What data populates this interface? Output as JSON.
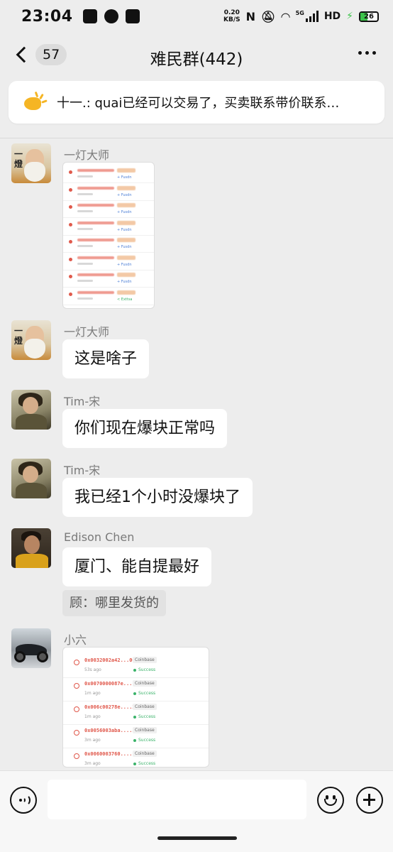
{
  "status_bar": {
    "time": "23:04",
    "net_speed_value": "0.20",
    "net_speed_unit": "KB/S",
    "network": "HD",
    "signal_label": "5G",
    "battery": "26",
    "left_icons": [
      "telegram-icon",
      "wechat-icon",
      "qq-icon"
    ],
    "right_icons": [
      "nfc-icon",
      "mute-icon",
      "wifi-icon",
      "signal-icon",
      "charging-icon",
      "battery-icon"
    ]
  },
  "nav": {
    "back_count": "57",
    "title": "难民群(442)"
  },
  "announcement": {
    "text": "十一.: quai已经可以交易了，买卖联系带价联系…"
  },
  "messages": [
    {
      "sender": "一灯大师",
      "type": "image"
    },
    {
      "sender": "一灯大师",
      "type": "text",
      "text": "这是啥子"
    },
    {
      "sender": "Tim-宋",
      "type": "text",
      "text": "你们现在爆块正常吗"
    },
    {
      "sender": "Tim-宋",
      "type": "text",
      "text": "我已经1个小时没爆块了"
    },
    {
      "sender": "Edison Chen",
      "type": "text",
      "text": "厦门、能自提最好",
      "quote": "顾：哪里发货的"
    },
    {
      "sender": "小六",
      "type": "image"
    }
  ],
  "screenshot_1": {
    "rows": [
      {
        "status": "+ Fusdn"
      },
      {
        "status": "+ Fusdn"
      },
      {
        "status": "+ Fusdn"
      },
      {
        "status": "+ Fusdn"
      },
      {
        "status": "+ Fusdn"
      },
      {
        "status": "+ Fusdn"
      },
      {
        "status": "+ Fusdn"
      },
      {
        "status": "< Exttsa"
      }
    ]
  },
  "screenshot_2": {
    "rows": [
      {
        "hash": "0x0032002a42...005d",
        "ago": "53s ago",
        "tag": "Coinbase",
        "status": "Success"
      },
      {
        "hash": "0x0070000087e....aafc4",
        "ago": "1m ago",
        "tag": "Coinbase",
        "status": "Success"
      },
      {
        "hash": "0x006c00278e....26ad",
        "ago": "1m ago",
        "tag": "Coinbase",
        "status": "Success"
      },
      {
        "hash": "0x0056003aba....5242",
        "ago": "3m ago",
        "tag": "Coinbase",
        "status": "Success"
      },
      {
        "hash": "0x0060003760....fc84",
        "ago": "3m ago",
        "tag": "Coinbase",
        "status": "Success"
      }
    ]
  },
  "input": {
    "placeholder": "",
    "value": ""
  },
  "colors": {
    "background": "#ededed",
    "bubble": "#ffffff",
    "announcement_icon": "#f5b524",
    "success": "#3bb36a",
    "tx_hash": "#e0574a"
  }
}
